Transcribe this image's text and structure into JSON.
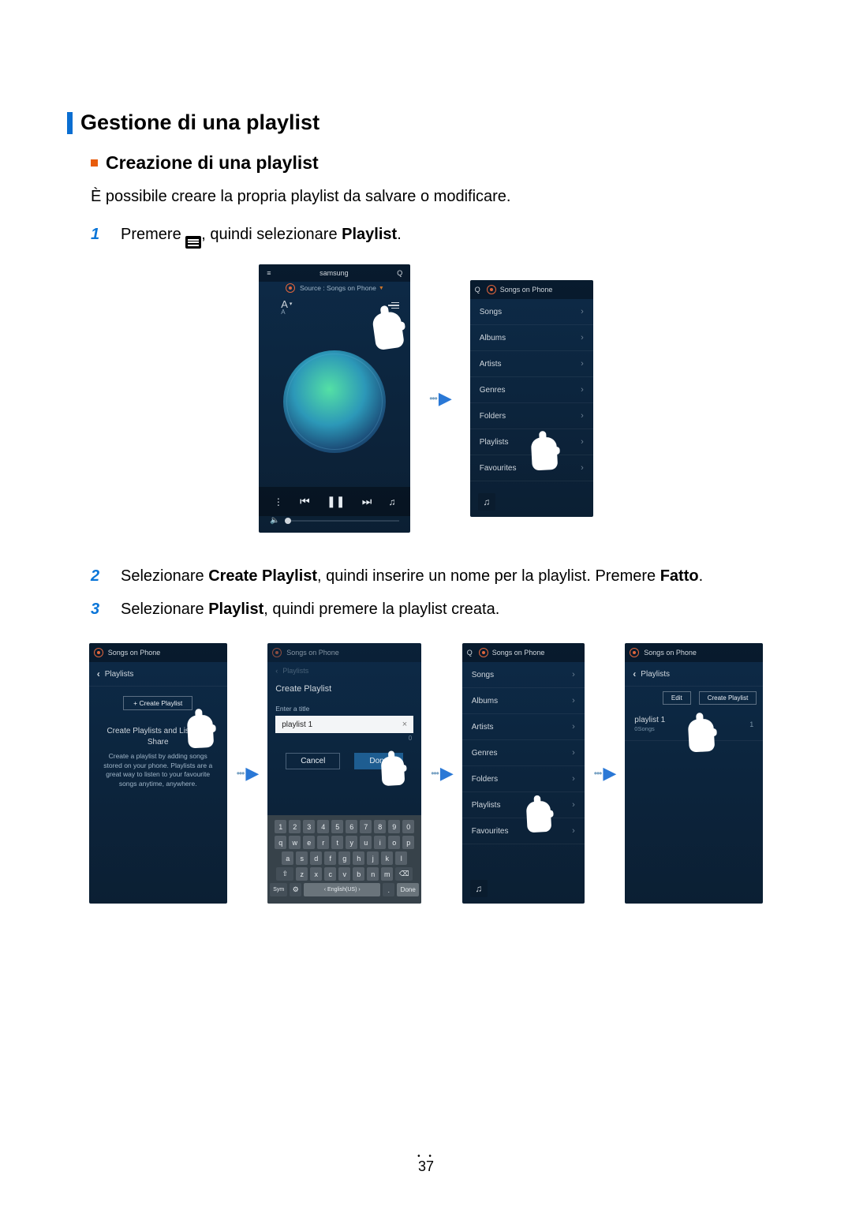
{
  "headings": {
    "main": "Gestione di una playlist",
    "sub": "Creazione di una playlist"
  },
  "intro_text": "È possibile creare la propria playlist da salvare o modificare.",
  "steps": {
    "s1_pre": "Premere ",
    "s1_post": ", quindi selezionare ",
    "s1_b1": "Playlist",
    "s1_end": ".",
    "s2_a": "Selezionare ",
    "s2_b": "Create Playlist",
    "s2_c": ", quindi inserire un nome per la playlist. Premere ",
    "s2_d": "Fatto",
    "s2_e": ".",
    "s3_a": "Selezionare ",
    "s3_b": "Playlist",
    "s3_c": ", quindi premere la playlist creata."
  },
  "step_numbers": {
    "n1": "1",
    "n2": "2",
    "n3": "3"
  },
  "phone_main": {
    "title": "samsung",
    "source": "Source : Songs on Phone",
    "sort_primary": "A",
    "sort_secondary": "A"
  },
  "icons": {
    "search": "Q",
    "eq": "≡",
    "prev": "⏮",
    "play": "❚❚",
    "next": "⏭",
    "more": "⋮",
    "speaker": "♫",
    "mute": "◀̵"
  },
  "categories_header": "Songs on Phone",
  "categories": [
    "Songs",
    "Albums",
    "Artists",
    "Genres",
    "Folders",
    "Playlists",
    "Favourites"
  ],
  "row2": {
    "p1": {
      "header": "Songs on Phone",
      "back": "Playlists",
      "create_btn": "+ Create Playlist",
      "e_title": "Create Playlists and Listen to Share",
      "e_body": "Create a playlist by adding songs stored on your phone. Playlists are a great way to listen to your favourite songs anytime, anywhere."
    },
    "p2": {
      "header": "Songs on Phone",
      "back": "Playlists",
      "dlg_title": "Create Playlist",
      "sub": "Enter a title",
      "value": "playlist 1",
      "counter": "0",
      "cancel": "Cancel",
      "done": "Done"
    },
    "p3": {
      "header": "Songs on Phone"
    },
    "p4": {
      "header": "Songs on Phone",
      "back": "Playlists",
      "edit": "Edit",
      "create": "Create Playlist",
      "item_name": "playlist 1",
      "item_sub": "0Songs",
      "item_num": "1"
    }
  },
  "keyboard": {
    "row_num": [
      "1",
      "2",
      "3",
      "4",
      "5",
      "6",
      "7",
      "8",
      "9",
      "0"
    ],
    "row1": [
      "q",
      "w",
      "e",
      "r",
      "t",
      "y",
      "u",
      "i",
      "o",
      "p"
    ],
    "row2": [
      "a",
      "s",
      "d",
      "f",
      "g",
      "h",
      "j",
      "k",
      "l"
    ],
    "row3_shift": "⇧",
    "row3": [
      "z",
      "x",
      "c",
      "v",
      "b",
      "n",
      "m"
    ],
    "row3_del": "⌫",
    "row4_sym": "Sym",
    "row4_alt": "⚙",
    "row4_space": "‹ English(US) ›",
    "row4_dot": ".",
    "row4_done": "Done"
  },
  "page_number": "37"
}
